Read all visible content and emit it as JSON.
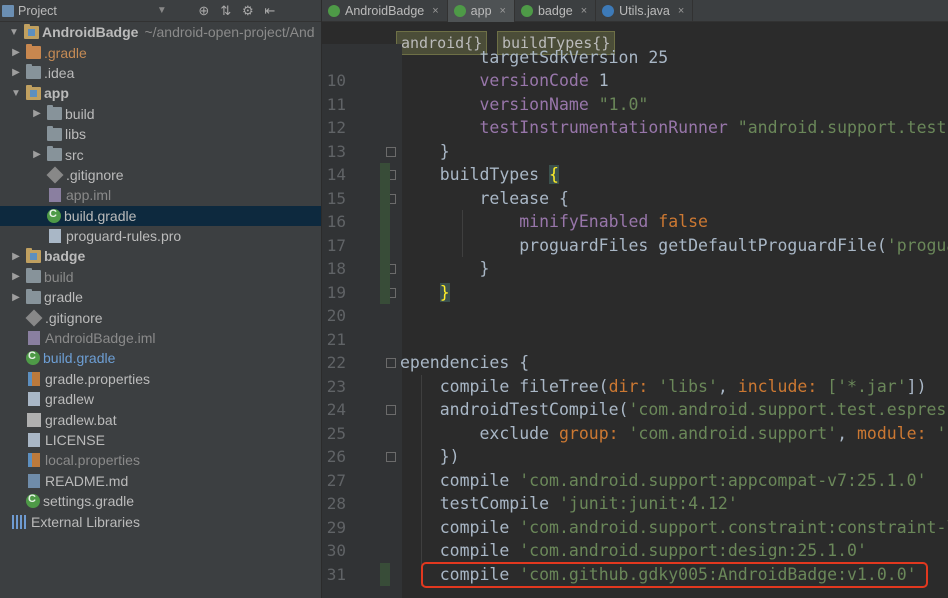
{
  "project_panel": {
    "title": "Project",
    "tree": [
      {
        "name": "tree-root",
        "label": "AndroidBadge",
        "path": "~/android-open-project/And",
        "icon": "module-folder-icon",
        "depth": 0,
        "expanded": true,
        "style": "bold"
      },
      {
        "name": "tree-gradle-dir",
        "label": ".gradle",
        "icon": "folder-icon",
        "depth": 1,
        "collapsed": true,
        "style": "orange"
      },
      {
        "name": "tree-idea-dir",
        "label": ".idea",
        "icon": "folder-icon",
        "depth": 1,
        "collapsed": true
      },
      {
        "name": "tree-app",
        "label": "app",
        "icon": "module-folder-icon",
        "depth": 1,
        "expanded": true,
        "style": "bold"
      },
      {
        "name": "tree-app-build",
        "label": "build",
        "icon": "folder-icon",
        "depth": 2,
        "collapsed": true
      },
      {
        "name": "tree-app-libs",
        "label": "libs",
        "icon": "folder-icon",
        "depth": 2
      },
      {
        "name": "tree-app-src",
        "label": "src",
        "icon": "folder-icon",
        "depth": 2,
        "collapsed": true
      },
      {
        "name": "tree-app-gitignore",
        "label": ".gitignore",
        "icon": "git-file-icon",
        "depth": 2
      },
      {
        "name": "tree-app-iml",
        "label": "app.iml",
        "icon": "iml-file-icon",
        "depth": 2,
        "style": "dim"
      },
      {
        "name": "tree-app-build-gradle",
        "label": "build.gradle",
        "icon": "gradle-file-icon",
        "depth": 2,
        "selected": true
      },
      {
        "name": "tree-app-proguard",
        "label": "proguard-rules.pro",
        "icon": "text-file-icon",
        "depth": 2
      },
      {
        "name": "tree-badge",
        "label": "badge",
        "icon": "module-folder-icon",
        "depth": 1,
        "collapsed": true,
        "style": "bold"
      },
      {
        "name": "tree-build",
        "label": "build",
        "icon": "folder-icon",
        "depth": 1,
        "collapsed": true,
        "style": "dim"
      },
      {
        "name": "tree-gradle",
        "label": "gradle",
        "icon": "folder-icon",
        "depth": 1,
        "collapsed": true
      },
      {
        "name": "tree-gitignore",
        "label": ".gitignore",
        "icon": "git-file-icon",
        "depth": 1
      },
      {
        "name": "tree-androidbadge-iml",
        "label": "AndroidBadge.iml",
        "icon": "iml-file-icon",
        "depth": 1,
        "style": "dim"
      },
      {
        "name": "tree-build-gradle",
        "label": "build.gradle",
        "icon": "gradle-file-icon",
        "depth": 1,
        "style": "blue"
      },
      {
        "name": "tree-gradle-properties",
        "label": "gradle.properties",
        "icon": "properties-file-icon",
        "depth": 1
      },
      {
        "name": "tree-gradlew",
        "label": "gradlew",
        "icon": "text-file-icon",
        "depth": 1
      },
      {
        "name": "tree-gradlew-bat",
        "label": "gradlew.bat",
        "icon": "bat-file-icon",
        "depth": 1
      },
      {
        "name": "tree-license",
        "label": "LICENSE",
        "icon": "text-file-icon",
        "depth": 1
      },
      {
        "name": "tree-local-properties",
        "label": "local.properties",
        "icon": "properties-file-icon",
        "depth": 1,
        "style": "dim"
      },
      {
        "name": "tree-readme",
        "label": "README.md",
        "icon": "markdown-file-icon",
        "depth": 1
      },
      {
        "name": "tree-settings-gradle",
        "label": "settings.gradle",
        "icon": "gradle-file-icon",
        "depth": 1
      },
      {
        "name": "tree-external-libraries",
        "label": "External Libraries",
        "icon": "libraries-icon",
        "depth": 0
      }
    ]
  },
  "tabs": [
    {
      "label": "AndroidBadge",
      "icon": "gradle-icon",
      "active": false
    },
    {
      "label": "app",
      "icon": "gradle-icon",
      "active": true
    },
    {
      "label": "badge",
      "icon": "gradle-icon",
      "active": false
    },
    {
      "label": "Utils.java",
      "icon": "java-class-icon",
      "active": false
    }
  ],
  "breadcrumb": [
    "android{}",
    "buildTypes{}"
  ],
  "code_lines": [
    {
      "n": "10",
      "tokens": [
        [
          "        ",
          "plain"
        ],
        [
          "versionCode",
          "purple"
        ],
        [
          " 1",
          "plain"
        ]
      ]
    },
    {
      "n": "11",
      "tokens": [
        [
          "        ",
          "plain"
        ],
        [
          "versionName",
          "purple"
        ],
        [
          " \"1.0\"",
          "str"
        ]
      ]
    },
    {
      "n": "12",
      "tokens": [
        [
          "        ",
          "plain"
        ],
        [
          "testInstrumentationRunner",
          "purple"
        ],
        [
          " \"android.support.test.ru",
          "str"
        ]
      ]
    },
    {
      "n": "13",
      "tokens": [
        [
          "    }",
          "plain"
        ]
      ]
    },
    {
      "n": "14",
      "tokens": [
        [
          "    buildTypes ",
          "plain"
        ],
        [
          "{",
          "brace-hl"
        ]
      ]
    },
    {
      "n": "15",
      "tokens": [
        [
          "        release {",
          "plain"
        ]
      ]
    },
    {
      "n": "16",
      "tokens": [
        [
          "            ",
          "plain"
        ],
        [
          "minifyEnabled",
          "purple"
        ],
        [
          " false",
          "key"
        ]
      ]
    },
    {
      "n": "17",
      "tokens": [
        [
          "            proguardFiles getDefaultProguardFile(",
          "plain"
        ],
        [
          "'proguard",
          "str"
        ]
      ]
    },
    {
      "n": "18",
      "tokens": [
        [
          "        }",
          "plain"
        ]
      ]
    },
    {
      "n": "19",
      "tokens": [
        [
          "    ",
          "plain"
        ],
        [
          "}",
          "brace-hl"
        ]
      ]
    },
    {
      "n": "20",
      "tokens": []
    },
    {
      "n": "21",
      "tokens": []
    },
    {
      "n": "22",
      "tokens": [
        [
          "ependencies {",
          "plain"
        ]
      ]
    },
    {
      "n": "23",
      "tokens": [
        [
          "    compile fileTree(",
          "plain"
        ],
        [
          "dir: ",
          "label"
        ],
        [
          "'libs'",
          "str"
        ],
        [
          ", ",
          "plain"
        ],
        [
          "include: ",
          "label"
        ],
        [
          "['*.jar'",
          "str"
        ],
        [
          "])",
          "plain"
        ]
      ]
    },
    {
      "n": "24",
      "tokens": [
        [
          "    androidTestCompile(",
          "plain"
        ],
        [
          "'com.android.support.test.espresso:",
          "str"
        ]
      ]
    },
    {
      "n": "25",
      "tokens": [
        [
          "        exclude ",
          "plain"
        ],
        [
          "group: ",
          "label"
        ],
        [
          "'com.android.support'",
          "str"
        ],
        [
          ", ",
          "plain"
        ],
        [
          "module: ",
          "label"
        ],
        [
          "'sup",
          "str"
        ]
      ]
    },
    {
      "n": "26",
      "tokens": [
        [
          "    })",
          "plain"
        ]
      ]
    },
    {
      "n": "27",
      "tokens": [
        [
          "    compile ",
          "plain"
        ],
        [
          "'com.android.support:appcompat-v7:25.1.0'",
          "str"
        ]
      ]
    },
    {
      "n": "28",
      "tokens": [
        [
          "    testCompile ",
          "plain"
        ],
        [
          "'junit:junit:4.12'",
          "str"
        ]
      ]
    },
    {
      "n": "29",
      "tokens": [
        [
          "    compile ",
          "plain"
        ],
        [
          "'com.android.support.constraint:constraint-lay",
          "str"
        ]
      ]
    },
    {
      "n": "30",
      "tokens": [
        [
          "    compile ",
          "plain"
        ],
        [
          "'com.android.support:design:25.1.0'",
          "str"
        ]
      ]
    },
    {
      "n": "31",
      "tokens": [
        [
          "    compile ",
          "plain"
        ],
        [
          "'com.github.gdky005:AndroidBadge:v1.0.0'",
          "str"
        ]
      ]
    }
  ],
  "partial_top_line": "        targetSdkVersion 25",
  "highlight_color": "#e2381f"
}
